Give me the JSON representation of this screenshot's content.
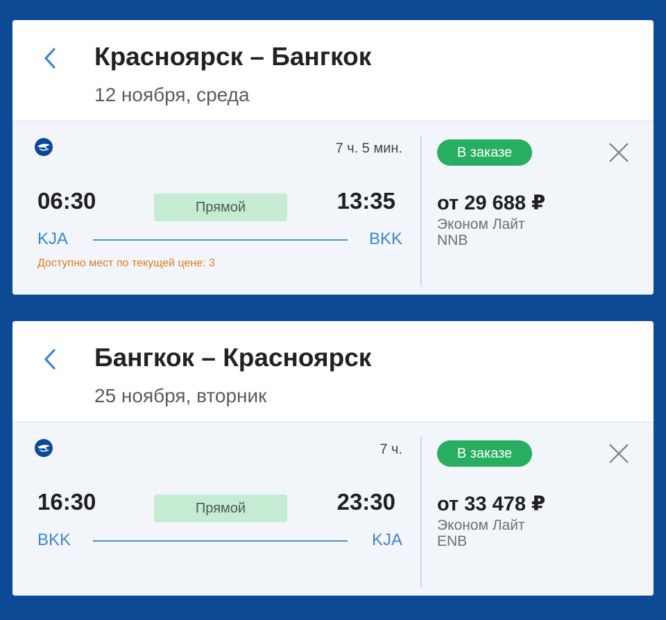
{
  "flights": [
    {
      "route_title": "Красноярск – Бангкок",
      "date": "12 ноября, среда",
      "airline_logo": "aeroflot-logo-icon",
      "duration": "7 ч. 5 мин.",
      "departure_time": "06:30",
      "arrival_time": "13:35",
      "flight_type": "Прямой",
      "departure_code": "KJA",
      "arrival_code": "BKK",
      "seats_note": "Доступно мест по текущей цене: 3",
      "status": "В заказе",
      "price": "от 29 688 ₽",
      "fare_class": "Эконом Лайт",
      "fare_code": "NNB"
    },
    {
      "route_title": "Бангкок – Красноярск",
      "date": "25 ноября, вторник",
      "airline_logo": "aeroflot-logo-icon",
      "duration": "7 ч.",
      "departure_time": "16:30",
      "arrival_time": "23:30",
      "flight_type": "Прямой",
      "departure_code": "BKK",
      "arrival_code": "KJA",
      "seats_note": "",
      "status": "В заказе",
      "price": "от 33 478 ₽",
      "fare_class": "Эконом Лайт",
      "fare_code": "ENB"
    }
  ],
  "colors": {
    "background": "#0d4a96",
    "accent_blue": "#3f86c7",
    "status_green": "#27ae60",
    "direct_badge": "#c5ecd3",
    "seats_warning": "#e07a1d"
  },
  "icons": {
    "back": "chevron-left-icon",
    "close": "close-icon"
  }
}
